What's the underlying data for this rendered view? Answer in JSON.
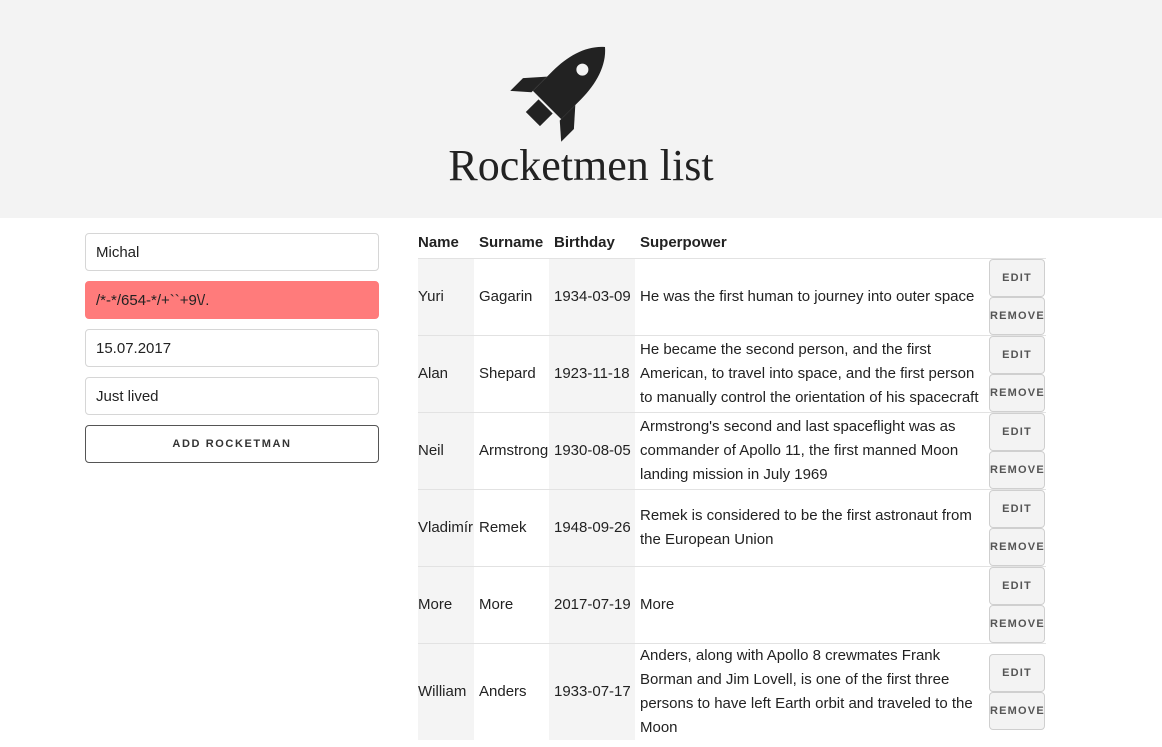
{
  "header": {
    "icon": "rocket-icon",
    "title": "Rocketmen list"
  },
  "form": {
    "name_value": "Michal",
    "surname_value": "/*-*/654-*/+``+9\\/.",
    "birthday_value": "15.07.2017",
    "superpower_value": "Just lived",
    "add_label": "ADD ROCKETMAN",
    "error_color": "#ff7b7b"
  },
  "table": {
    "headers": [
      "Name",
      "Surname",
      "Birthday",
      "Superpower"
    ],
    "edit_label": "EDIT",
    "remove_label": "REMOVE",
    "rows": [
      {
        "name": "Yuri",
        "surname": "Gagarin",
        "birthday": "1934-03-09",
        "superpower": "He was the first human to journey into outer space"
      },
      {
        "name": "Alan",
        "surname": "Shepard",
        "birthday": "1923-11-18",
        "superpower": "He became the second person, and the first American, to travel into space, and the first person to manually control the orientation of his spacecraft"
      },
      {
        "name": "Neil",
        "surname": "Armstrong",
        "birthday": "1930-08-05",
        "superpower": "Armstrong's second and last spaceflight was as commander of Apollo 11, the first manned Moon landing mission in July 1969"
      },
      {
        "name": "Vladimír",
        "surname": "Remek",
        "birthday": "1948-09-26",
        "superpower": "Remek is considered to be the first astronaut from the European Union"
      },
      {
        "name": "More",
        "surname": "More",
        "birthday": "2017-07-19",
        "superpower": "More"
      },
      {
        "name": "William",
        "surname": "Anders",
        "birthday": "1933-07-17",
        "superpower": "Anders, along with Apollo 8 crewmates Frank Borman and Jim Lovell, is one of the first three persons to have left Earth orbit and traveled to the Moon"
      }
    ]
  }
}
